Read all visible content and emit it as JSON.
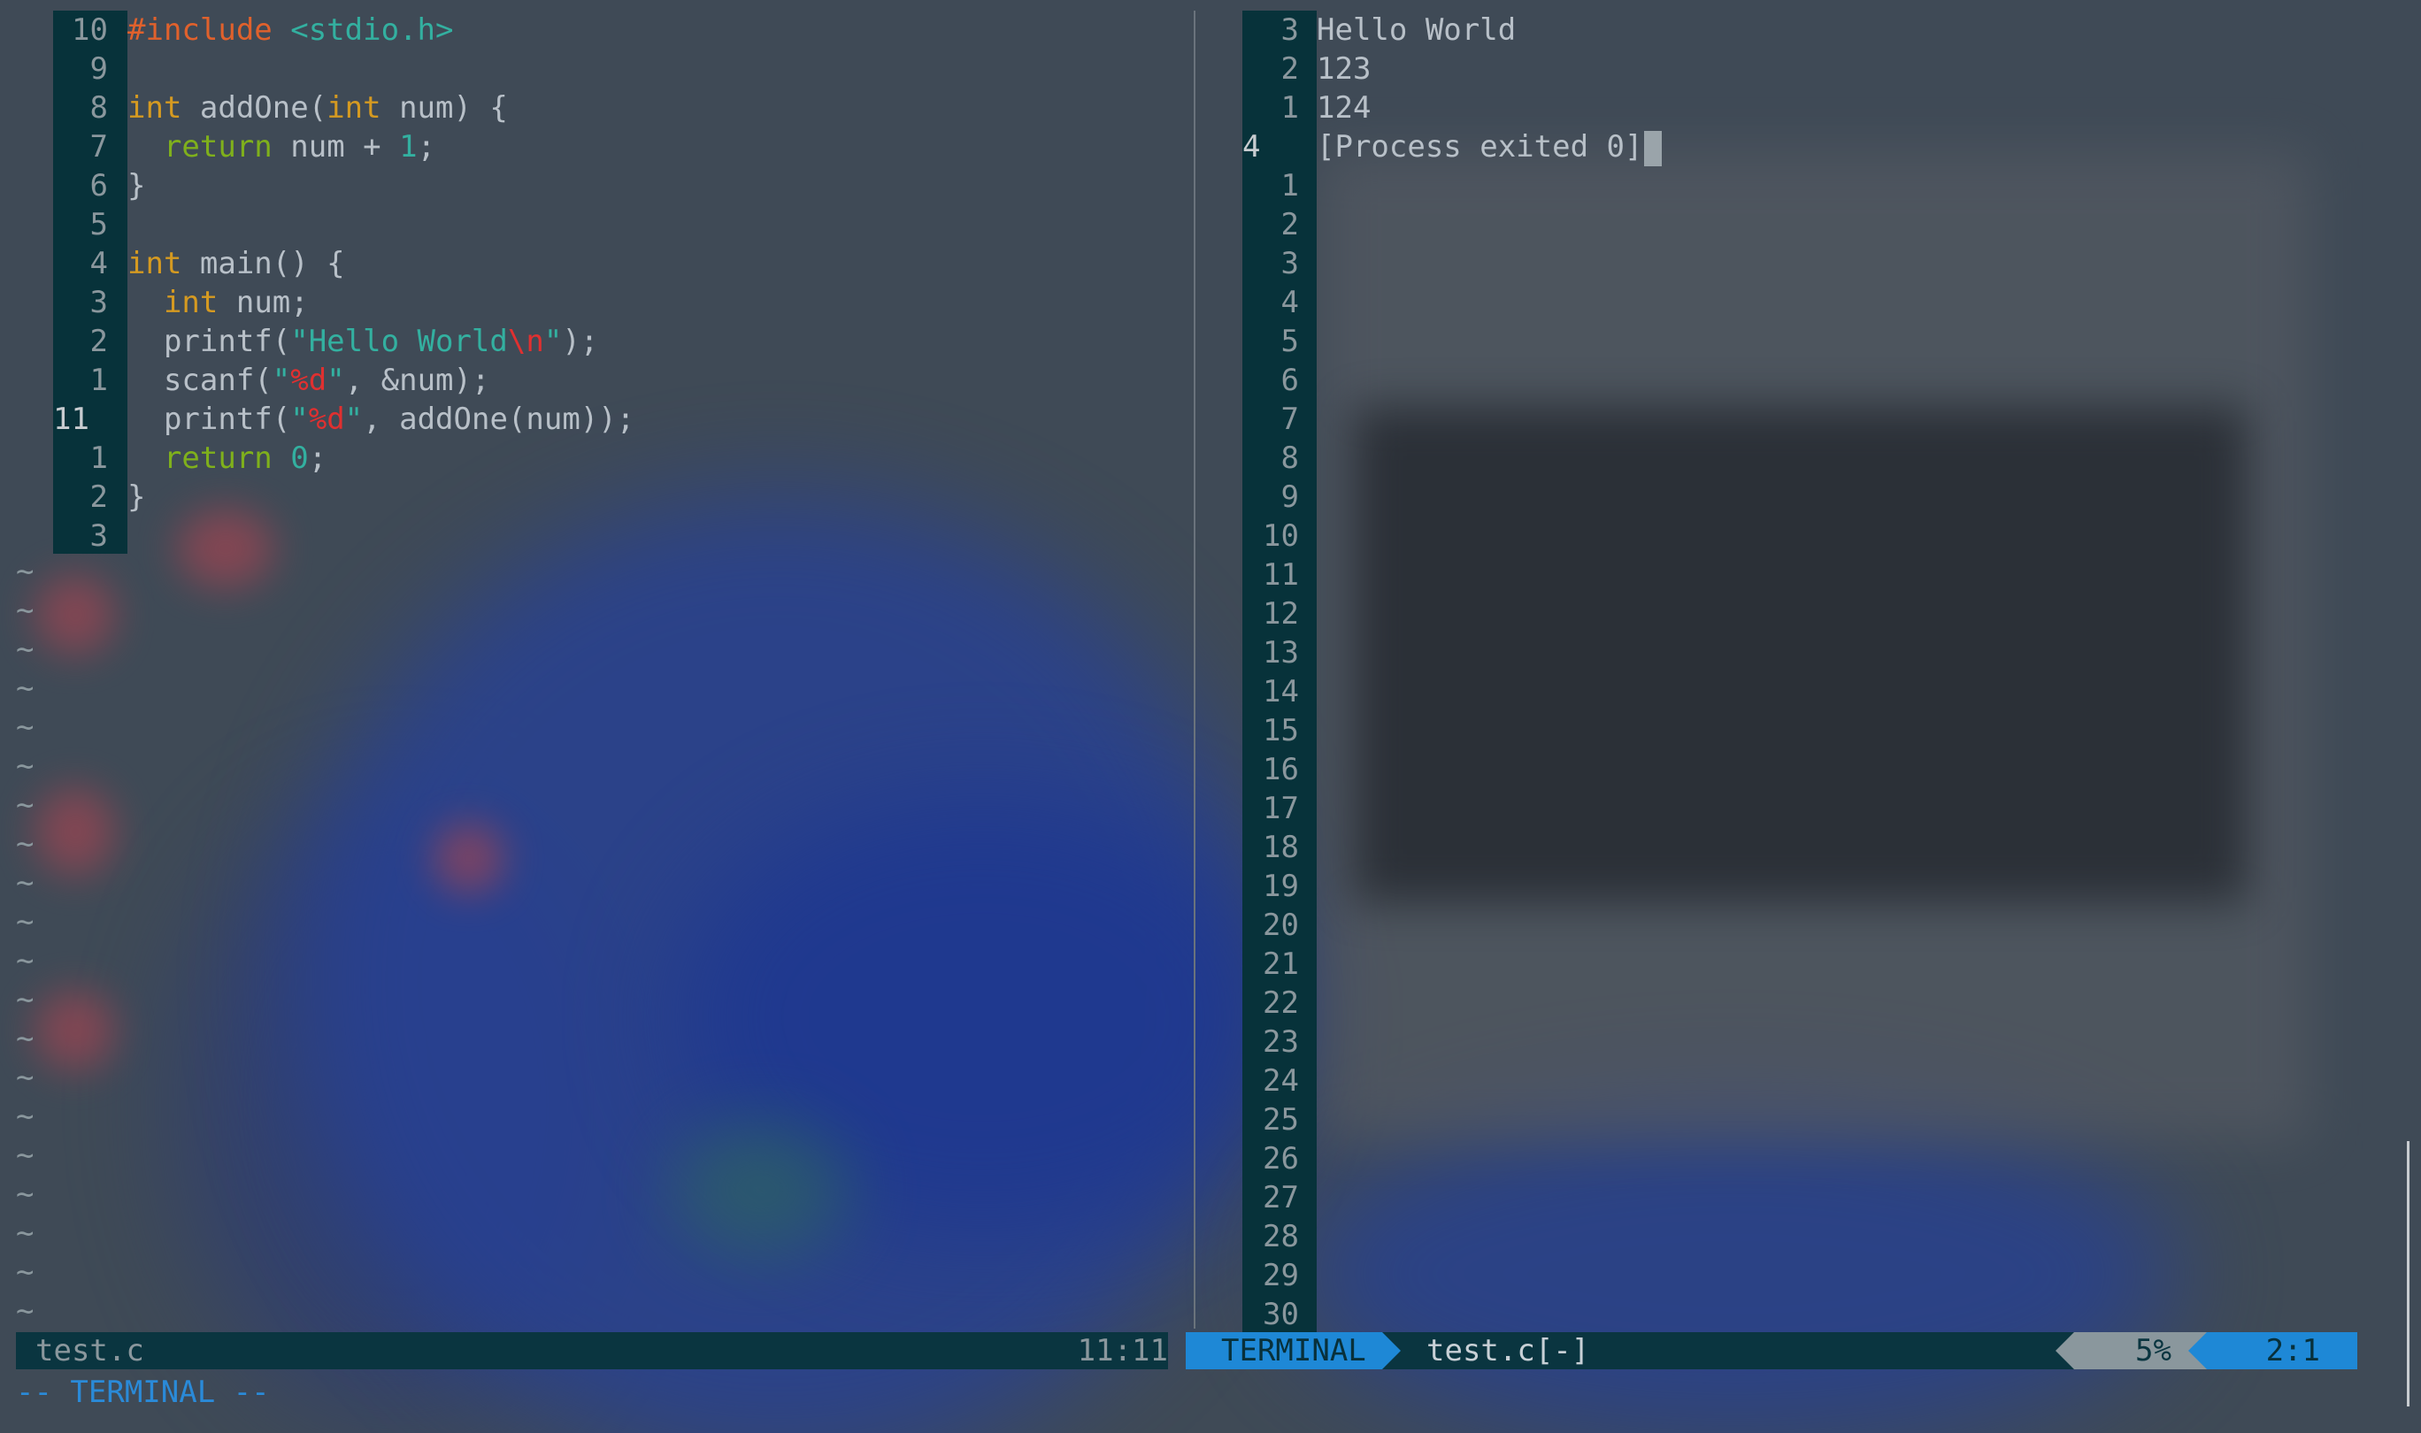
{
  "theme": {
    "gutter_bg": "#07323a",
    "accent": "#1e88d6",
    "comment_grey": "#8a979d"
  },
  "editor": {
    "lines": [
      {
        "num": "10",
        "current": false,
        "tokens": [
          {
            "t": "#include ",
            "c": "pp"
          },
          {
            "t": "<stdio.h>",
            "c": "str"
          }
        ]
      },
      {
        "num": "9",
        "current": false,
        "tokens": []
      },
      {
        "num": "8",
        "current": false,
        "tokens": [
          {
            "t": "int",
            "c": "kw"
          },
          {
            "t": " addOne(",
            "c": "plain"
          },
          {
            "t": "int",
            "c": "kw"
          },
          {
            "t": " num) {",
            "c": "plain"
          }
        ]
      },
      {
        "num": "7",
        "current": false,
        "tokens": [
          {
            "t": "  ",
            "c": "plain"
          },
          {
            "t": "return",
            "c": "ctl"
          },
          {
            "t": " num + ",
            "c": "plain"
          },
          {
            "t": "1",
            "c": "num-lit"
          },
          {
            "t": ";",
            "c": "plain"
          }
        ]
      },
      {
        "num": "6",
        "current": false,
        "tokens": [
          {
            "t": "}",
            "c": "plain"
          }
        ]
      },
      {
        "num": "5",
        "current": false,
        "tokens": []
      },
      {
        "num": "4",
        "current": false,
        "tokens": [
          {
            "t": "int",
            "c": "kw"
          },
          {
            "t": " main() {",
            "c": "plain"
          }
        ]
      },
      {
        "num": "3",
        "current": false,
        "tokens": [
          {
            "t": "  ",
            "c": "plain"
          },
          {
            "t": "int",
            "c": "kw"
          },
          {
            "t": " num;",
            "c": "plain"
          }
        ]
      },
      {
        "num": "2",
        "current": false,
        "tokens": [
          {
            "t": "  printf(",
            "c": "plain"
          },
          {
            "t": "\"Hello World",
            "c": "str"
          },
          {
            "t": "\\n",
            "c": "esc"
          },
          {
            "t": "\"",
            "c": "str"
          },
          {
            "t": ");",
            "c": "plain"
          }
        ]
      },
      {
        "num": "1",
        "current": false,
        "tokens": [
          {
            "t": "  scanf(",
            "c": "plain"
          },
          {
            "t": "\"",
            "c": "str"
          },
          {
            "t": "%d",
            "c": "esc"
          },
          {
            "t": "\"",
            "c": "str"
          },
          {
            "t": ", &num);",
            "c": "plain"
          }
        ]
      },
      {
        "num": "11",
        "current": true,
        "tokens": [
          {
            "t": "  printf(",
            "c": "plain"
          },
          {
            "t": "\"",
            "c": "str"
          },
          {
            "t": "%d",
            "c": "esc"
          },
          {
            "t": "\"",
            "c": "str"
          },
          {
            "t": ", addOne(num));",
            "c": "plain"
          }
        ]
      },
      {
        "num": "1",
        "current": false,
        "tokens": [
          {
            "t": "  ",
            "c": "plain"
          },
          {
            "t": "return",
            "c": "ctl"
          },
          {
            "t": " ",
            "c": "plain"
          },
          {
            "t": "0",
            "c": "num-lit"
          },
          {
            "t": ";",
            "c": "plain"
          }
        ]
      },
      {
        "num": "2",
        "current": false,
        "tokens": [
          {
            "t": "}",
            "c": "plain"
          }
        ]
      },
      {
        "num": "3",
        "current": false,
        "tokens": []
      }
    ],
    "tilde_count": 20,
    "tilde_char": "~"
  },
  "terminal": {
    "lines": [
      {
        "num": "3",
        "current": false,
        "text": "Hello World"
      },
      {
        "num": "2",
        "current": false,
        "text": "123"
      },
      {
        "num": "1",
        "current": false,
        "text": "124"
      },
      {
        "num": "4",
        "current": true,
        "text": "[Process exited 0]"
      },
      {
        "num": "1",
        "current": false,
        "text": ""
      },
      {
        "num": "2",
        "current": false,
        "text": ""
      },
      {
        "num": "3",
        "current": false,
        "text": ""
      },
      {
        "num": "4",
        "current": false,
        "text": ""
      },
      {
        "num": "5",
        "current": false,
        "text": ""
      },
      {
        "num": "6",
        "current": false,
        "text": ""
      },
      {
        "num": "7",
        "current": false,
        "text": ""
      },
      {
        "num": "8",
        "current": false,
        "text": ""
      },
      {
        "num": "9",
        "current": false,
        "text": ""
      },
      {
        "num": "10",
        "current": false,
        "text": ""
      },
      {
        "num": "11",
        "current": false,
        "text": ""
      },
      {
        "num": "12",
        "current": false,
        "text": ""
      },
      {
        "num": "13",
        "current": false,
        "text": ""
      },
      {
        "num": "14",
        "current": false,
        "text": ""
      },
      {
        "num": "15",
        "current": false,
        "text": ""
      },
      {
        "num": "16",
        "current": false,
        "text": ""
      },
      {
        "num": "17",
        "current": false,
        "text": ""
      },
      {
        "num": "18",
        "current": false,
        "text": ""
      },
      {
        "num": "19",
        "current": false,
        "text": ""
      },
      {
        "num": "20",
        "current": false,
        "text": ""
      },
      {
        "num": "21",
        "current": false,
        "text": ""
      },
      {
        "num": "22",
        "current": false,
        "text": ""
      },
      {
        "num": "23",
        "current": false,
        "text": ""
      },
      {
        "num": "24",
        "current": false,
        "text": ""
      },
      {
        "num": "25",
        "current": false,
        "text": ""
      },
      {
        "num": "26",
        "current": false,
        "text": ""
      },
      {
        "num": "27",
        "current": false,
        "text": ""
      },
      {
        "num": "28",
        "current": false,
        "text": ""
      },
      {
        "num": "29",
        "current": false,
        "text": ""
      },
      {
        "num": "30",
        "current": false,
        "text": ""
      }
    ]
  },
  "statusline": {
    "left_file": "test.c",
    "left_position": "11:11",
    "mode": "TERMINAL",
    "right_file": "test.c[-]",
    "percent": "5%",
    "line_col": "2:1"
  },
  "modeline": "-- TERMINAL --"
}
